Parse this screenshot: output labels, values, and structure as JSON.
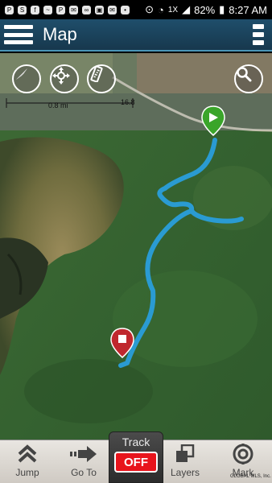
{
  "status_bar": {
    "battery": "82%",
    "time": "8:27 AM",
    "network": "1X"
  },
  "header": {
    "title": "Map"
  },
  "map": {
    "scale_label_left": "0.8 mi",
    "scale_label_right": "16.8",
    "track_color": "#2a9bd2",
    "start_marker_color": "#3aa52a",
    "end_marker_color": "#c0282e"
  },
  "toolbar": {
    "jump": "Jump",
    "goto": "Go To",
    "track_label": "Track",
    "track_state": "OFF",
    "layers": "Layers",
    "mark": "Mark"
  },
  "watermark": "GLOBAL MLS, Inc."
}
